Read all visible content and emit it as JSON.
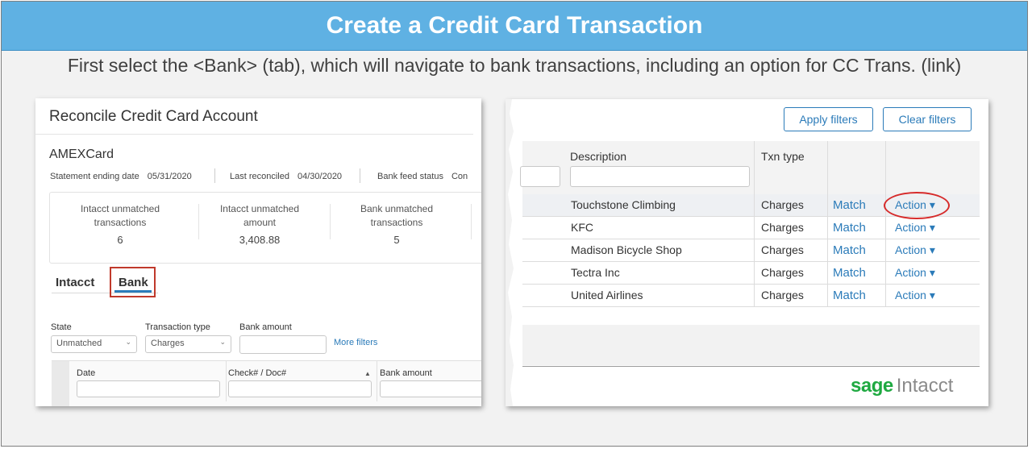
{
  "slide": {
    "title": "Create a Credit Card Transaction",
    "subtitle": "First select the <Bank> (tab), which will  navigate to bank transactions, including an option for CC Trans. (link)"
  },
  "left_panel": {
    "title": "Reconcile Credit Card Account",
    "card_name": "AMEXCard",
    "meta": {
      "statement_label": "Statement ending date",
      "statement_value": "05/31/2020",
      "last_reconciled_label": "Last reconciled",
      "last_reconciled_value": "04/30/2020",
      "bank_feed_label": "Bank feed status",
      "bank_feed_value": "Con"
    },
    "stats": [
      {
        "line1": "Intacct unmatched",
        "line2": "transactions",
        "value": "6"
      },
      {
        "line1": "Intacct unmatched",
        "line2": "amount",
        "value": "3,408.88"
      },
      {
        "line1": "Bank unmatched",
        "line2": "transactions",
        "value": "5"
      }
    ],
    "tabs": {
      "intacct": "Intacct",
      "bank": "Bank"
    },
    "filters": {
      "state_label": "State",
      "state_value": "Unmatched",
      "txn_type_label": "Transaction type",
      "txn_type_value": "Charges",
      "bank_amount_label": "Bank amount",
      "more_filters": "More filters"
    },
    "grid_columns": [
      "Date",
      "Check# / Doc#",
      "Bank amount"
    ]
  },
  "right_panel": {
    "apply_filters": "Apply filters",
    "clear_filters": "Clear filters",
    "columns": {
      "description": "Description",
      "txn_type": "Txn type"
    },
    "rows": [
      {
        "description": "Touchstone Climbing",
        "txn_type": "Charges",
        "match": "Match",
        "action": "Action"
      },
      {
        "description": "KFC",
        "txn_type": "Charges",
        "match": "Match",
        "action": "Action"
      },
      {
        "description": "Madison Bicycle Shop",
        "txn_type": "Charges",
        "match": "Match",
        "action": "Action"
      },
      {
        "description": "Tectra Inc",
        "txn_type": "Charges",
        "match": "Match",
        "action": "Action"
      },
      {
        "description": "United Airlines",
        "txn_type": "Charges",
        "match": "Match",
        "action": "Action"
      }
    ],
    "logo": {
      "sage": "sage",
      "intacct": "Intacct"
    }
  },
  "colors": {
    "title_bar": "#5fb1e3",
    "link_blue": "#2b7bb9",
    "highlight_red": "#d62a2a",
    "sage_green": "#1fa941"
  }
}
